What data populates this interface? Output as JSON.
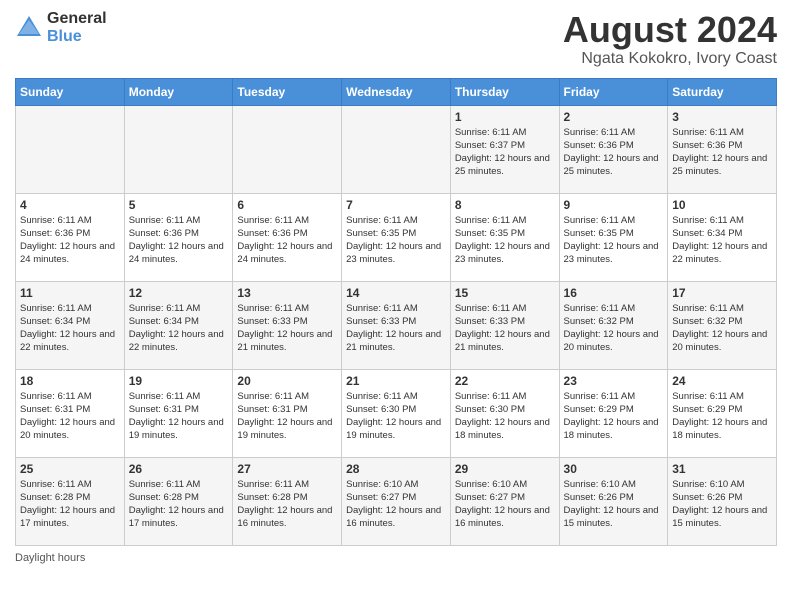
{
  "header": {
    "logo_general": "General",
    "logo_blue": "Blue",
    "main_title": "August 2024",
    "subtitle": "Ngata Kokokro, Ivory Coast"
  },
  "footer": {
    "label": "Daylight hours"
  },
  "days_of_week": [
    "Sunday",
    "Monday",
    "Tuesday",
    "Wednesday",
    "Thursday",
    "Friday",
    "Saturday"
  ],
  "weeks": [
    [
      {
        "day": "",
        "info": ""
      },
      {
        "day": "",
        "info": ""
      },
      {
        "day": "",
        "info": ""
      },
      {
        "day": "",
        "info": ""
      },
      {
        "day": "1",
        "info": "Sunrise: 6:11 AM\nSunset: 6:37 PM\nDaylight: 12 hours\nand 25 minutes."
      },
      {
        "day": "2",
        "info": "Sunrise: 6:11 AM\nSunset: 6:36 PM\nDaylight: 12 hours\nand 25 minutes."
      },
      {
        "day": "3",
        "info": "Sunrise: 6:11 AM\nSunset: 6:36 PM\nDaylight: 12 hours\nand 25 minutes."
      }
    ],
    [
      {
        "day": "4",
        "info": "Sunrise: 6:11 AM\nSunset: 6:36 PM\nDaylight: 12 hours\nand 24 minutes."
      },
      {
        "day": "5",
        "info": "Sunrise: 6:11 AM\nSunset: 6:36 PM\nDaylight: 12 hours\nand 24 minutes."
      },
      {
        "day": "6",
        "info": "Sunrise: 6:11 AM\nSunset: 6:36 PM\nDaylight: 12 hours\nand 24 minutes."
      },
      {
        "day": "7",
        "info": "Sunrise: 6:11 AM\nSunset: 6:35 PM\nDaylight: 12 hours\nand 23 minutes."
      },
      {
        "day": "8",
        "info": "Sunrise: 6:11 AM\nSunset: 6:35 PM\nDaylight: 12 hours\nand 23 minutes."
      },
      {
        "day": "9",
        "info": "Sunrise: 6:11 AM\nSunset: 6:35 PM\nDaylight: 12 hours\nand 23 minutes."
      },
      {
        "day": "10",
        "info": "Sunrise: 6:11 AM\nSunset: 6:34 PM\nDaylight: 12 hours\nand 22 minutes."
      }
    ],
    [
      {
        "day": "11",
        "info": "Sunrise: 6:11 AM\nSunset: 6:34 PM\nDaylight: 12 hours\nand 22 minutes."
      },
      {
        "day": "12",
        "info": "Sunrise: 6:11 AM\nSunset: 6:34 PM\nDaylight: 12 hours\nand 22 minutes."
      },
      {
        "day": "13",
        "info": "Sunrise: 6:11 AM\nSunset: 6:33 PM\nDaylight: 12 hours\nand 21 minutes."
      },
      {
        "day": "14",
        "info": "Sunrise: 6:11 AM\nSunset: 6:33 PM\nDaylight: 12 hours\nand 21 minutes."
      },
      {
        "day": "15",
        "info": "Sunrise: 6:11 AM\nSunset: 6:33 PM\nDaylight: 12 hours\nand 21 minutes."
      },
      {
        "day": "16",
        "info": "Sunrise: 6:11 AM\nSunset: 6:32 PM\nDaylight: 12 hours\nand 20 minutes."
      },
      {
        "day": "17",
        "info": "Sunrise: 6:11 AM\nSunset: 6:32 PM\nDaylight: 12 hours\nand 20 minutes."
      }
    ],
    [
      {
        "day": "18",
        "info": "Sunrise: 6:11 AM\nSunset: 6:31 PM\nDaylight: 12 hours\nand 20 minutes."
      },
      {
        "day": "19",
        "info": "Sunrise: 6:11 AM\nSunset: 6:31 PM\nDaylight: 12 hours\nand 19 minutes."
      },
      {
        "day": "20",
        "info": "Sunrise: 6:11 AM\nSunset: 6:31 PM\nDaylight: 12 hours\nand 19 minutes."
      },
      {
        "day": "21",
        "info": "Sunrise: 6:11 AM\nSunset: 6:30 PM\nDaylight: 12 hours\nand 19 minutes."
      },
      {
        "day": "22",
        "info": "Sunrise: 6:11 AM\nSunset: 6:30 PM\nDaylight: 12 hours\nand 18 minutes."
      },
      {
        "day": "23",
        "info": "Sunrise: 6:11 AM\nSunset: 6:29 PM\nDaylight: 12 hours\nand 18 minutes."
      },
      {
        "day": "24",
        "info": "Sunrise: 6:11 AM\nSunset: 6:29 PM\nDaylight: 12 hours\nand 18 minutes."
      }
    ],
    [
      {
        "day": "25",
        "info": "Sunrise: 6:11 AM\nSunset: 6:28 PM\nDaylight: 12 hours\nand 17 minutes."
      },
      {
        "day": "26",
        "info": "Sunrise: 6:11 AM\nSunset: 6:28 PM\nDaylight: 12 hours\nand 17 minutes."
      },
      {
        "day": "27",
        "info": "Sunrise: 6:11 AM\nSunset: 6:28 PM\nDaylight: 12 hours\nand 16 minutes."
      },
      {
        "day": "28",
        "info": "Sunrise: 6:10 AM\nSunset: 6:27 PM\nDaylight: 12 hours\nand 16 minutes."
      },
      {
        "day": "29",
        "info": "Sunrise: 6:10 AM\nSunset: 6:27 PM\nDaylight: 12 hours\nand 16 minutes."
      },
      {
        "day": "30",
        "info": "Sunrise: 6:10 AM\nSunset: 6:26 PM\nDaylight: 12 hours\nand 15 minutes."
      },
      {
        "day": "31",
        "info": "Sunrise: 6:10 AM\nSunset: 6:26 PM\nDaylight: 12 hours\nand 15 minutes."
      }
    ]
  ]
}
